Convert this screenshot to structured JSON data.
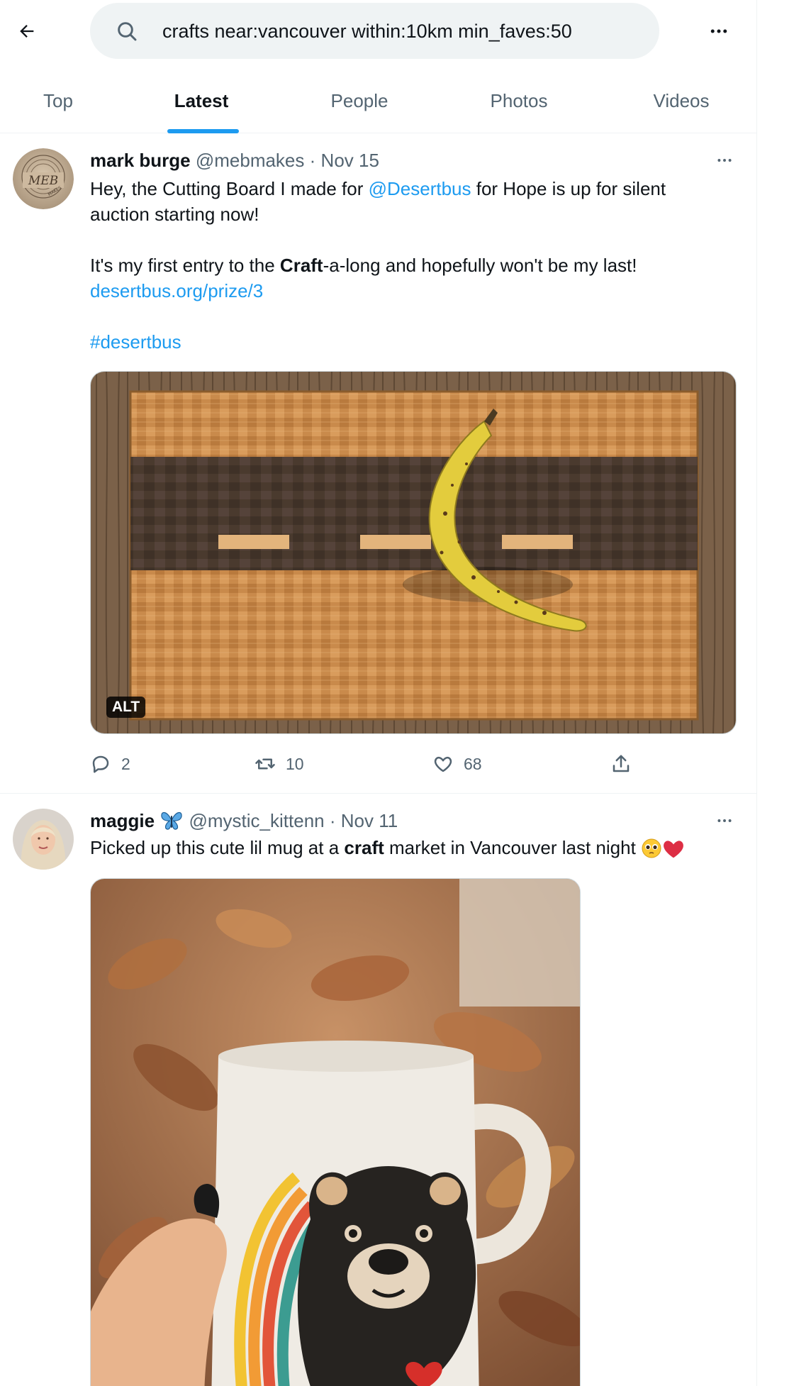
{
  "header": {
    "back_label": "Back",
    "search_query": "crafts near:vancouver within:10km min_faves:50"
  },
  "tabs": [
    {
      "label": "Top"
    },
    {
      "label": "Latest"
    },
    {
      "label": "People"
    },
    {
      "label": "Photos"
    },
    {
      "label": "Videos"
    }
  ],
  "colors": {
    "accent": "#1d9bf0",
    "muted": "#536471",
    "text": "#0f1419",
    "heart": "#e0245e"
  },
  "tweets": [
    {
      "name": "mark burge",
      "handle": "@mebmakes",
      "sep": "·",
      "date": "Nov 15",
      "avatar_text": "MEB",
      "avatar_sub": "MAKES",
      "line1_pre": "Hey, the Cutting Board I made for ",
      "line1_mention": "@Desertbus",
      "line1_post": " for Hope is up for silent auction starting now!",
      "line2_pre": "It's my first entry to the ",
      "line2_bold": "Craft",
      "line2_post": "-a-long and hopefully won't be  my last!",
      "link": "desertbus.org/prize/3",
      "hashtag": "#desertbus",
      "alt_badge": "ALT",
      "replies": "2",
      "retweets": "10",
      "likes": "68"
    },
    {
      "name": "maggie",
      "handle": "@mystic_kittenn",
      "sep": "·",
      "date": "Nov 11",
      "text_pre": "Picked up this cute lil mug at a ",
      "text_bold": "craft",
      "text_post": " market in Vancouver last night "
    }
  ]
}
